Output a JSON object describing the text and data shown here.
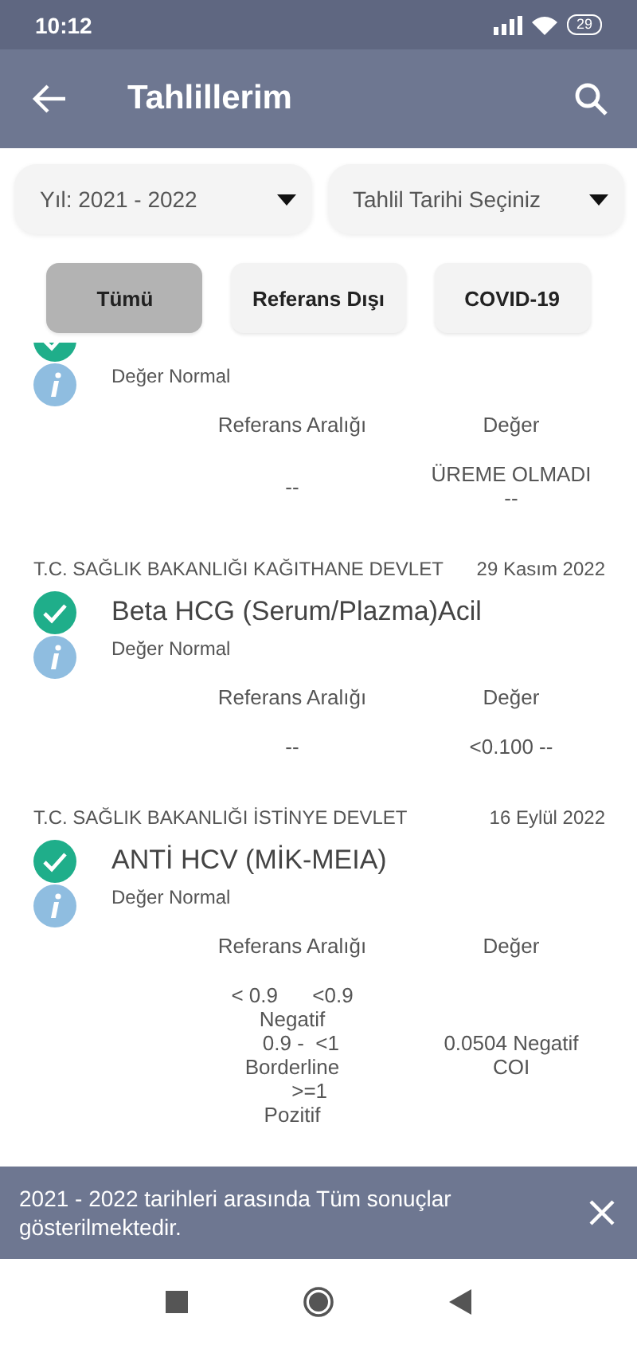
{
  "status_bar": {
    "time": "10:12",
    "battery": "29"
  },
  "app_bar": {
    "title": "Tahlillerim"
  },
  "filters": [
    {
      "label": "Yıl: 2021 - 2022"
    },
    {
      "label": "Tahlil Tarihi Seçiniz"
    }
  ],
  "chips": [
    {
      "label": "Tümü",
      "selected": true
    },
    {
      "label": "Referans Dışı",
      "selected": false
    },
    {
      "label": "COVID-19",
      "selected": false
    }
  ],
  "results": [
    {
      "normal": true,
      "note": "Değer Normal",
      "range_header": "Referans Aralığı",
      "value_header": "Değer",
      "range": "--",
      "value": "ÜREME OLMADI\n--"
    },
    {
      "hospital": "T.C. SAĞLIK BAKANLIĞI KAĞITHANE DEVLET",
      "date": "29 Kasım 2022",
      "name": "Beta HCG (Serum/Plazma)Acil",
      "normal": true,
      "note": "Değer Normal",
      "range_header": "Referans Aralığı",
      "value_header": "Değer",
      "range": "--",
      "value": "<0.100 --"
    },
    {
      "hospital": "T.C. SAĞLIK BAKANLIĞI İSTİNYE DEVLET",
      "date": "16 Eylül 2022",
      "name": "ANTİ HCV (MİK-MEIA)",
      "normal": true,
      "note": "Değer Normal",
      "range_header": "Referans Aralığı",
      "value_header": "Değer",
      "range": "< 0.9      <0.9\nNegatif\n   0.9 -  <1\nBorderline\n      >=1\nPozitif",
      "value": "0.0504 Negatif\nCOI"
    }
  ],
  "snackbar": {
    "message": "2021 - 2022 tarihleri arasında Tüm sonuçlar gösterilmektedir."
  }
}
